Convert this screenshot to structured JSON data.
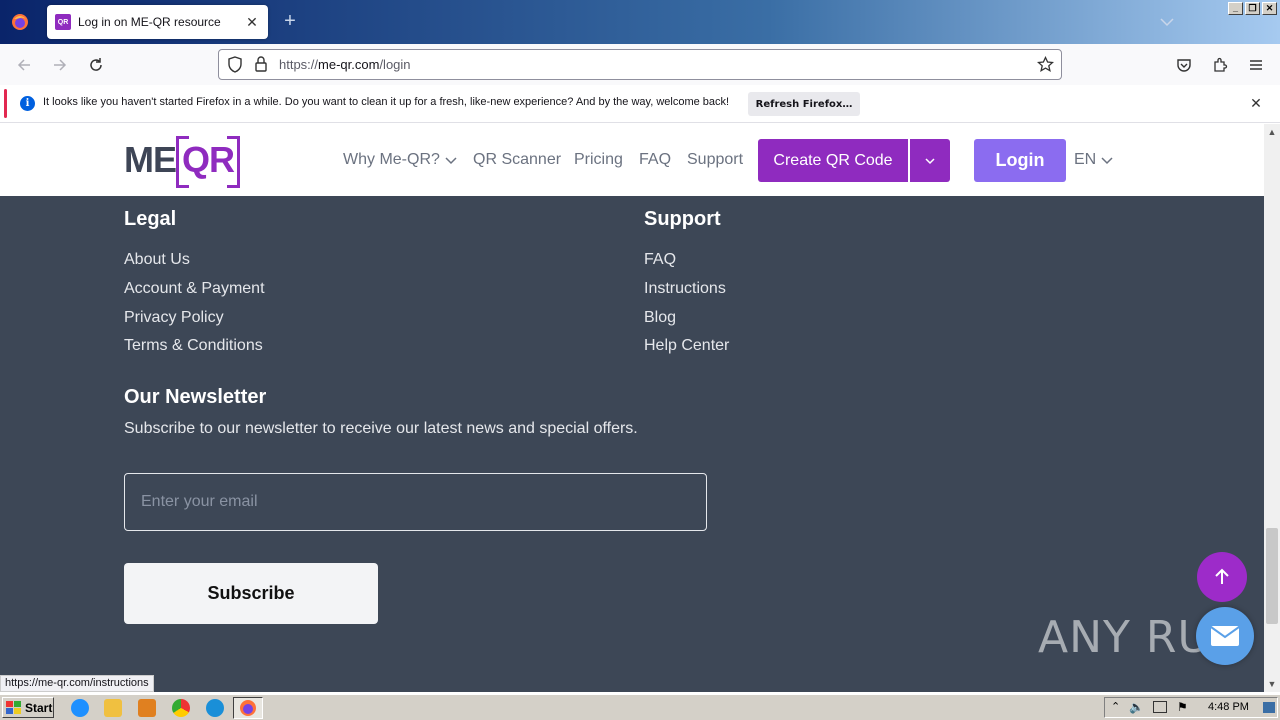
{
  "browser": {
    "tab_title": "Log in on ME-QR resource",
    "tab_favicon_text": "QR",
    "url_prefix": "https://",
    "url_host": "me-qr.com",
    "url_path": "/login",
    "notification_text": "It looks like you haven't started Firefox in a while. Do you want to clean it up for a fresh, like-new experience? And by the way, welcome back!",
    "notification_button": "Refresh Firefox…",
    "status_url": "https://me-qr.com/instructions"
  },
  "header": {
    "logo_me": "ME",
    "logo_qr": "QR",
    "nav": [
      "Why Me-QR?",
      "QR Scanner",
      "Pricing",
      "FAQ",
      "Support"
    ],
    "create_button": "Create QR Code",
    "login_button": "Login",
    "language": "EN",
    "brand_color": "#8f2bbf",
    "login_color": "#8b6cf0"
  },
  "footer": {
    "legal_heading": "Legal",
    "legal_links": [
      "About Us",
      "Account & Payment",
      "Privacy Policy",
      "Terms & Conditions"
    ],
    "support_heading": "Support",
    "support_links": [
      "FAQ",
      "Instructions",
      "Blog",
      "Help Center"
    ],
    "newsletter_heading": "Our Newsletter",
    "newsletter_desc": "Subscribe to our newsletter to receive our latest news and special offers.",
    "email_placeholder": "Enter your email",
    "subscribe_button": "Subscribe",
    "background_color": "#3d4756"
  },
  "watermark": "ANY RUN",
  "taskbar": {
    "start_label": "Start",
    "clock": "4:48 PM"
  }
}
